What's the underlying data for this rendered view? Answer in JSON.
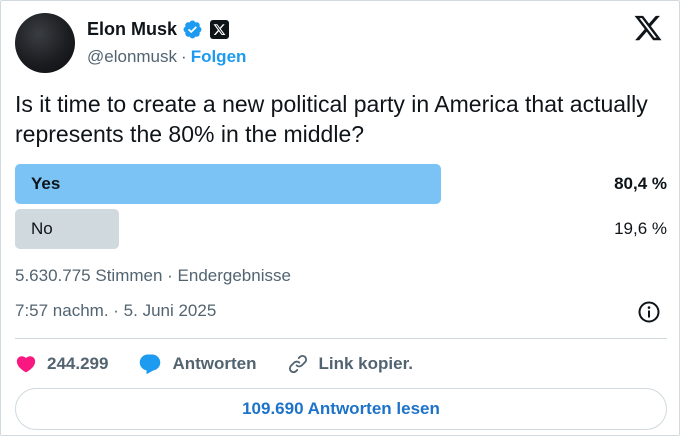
{
  "author": {
    "name": "Elon Musk",
    "handle": "@elonmusk",
    "separator": "·",
    "follow_label": "Folgen"
  },
  "tweet": {
    "text": "Is it time to create a new political party in America that actually represents the 80% in the middle?"
  },
  "poll": {
    "options": [
      {
        "label": "Yes",
        "percent_text": "80,4 %",
        "percent": 80.4,
        "winner": true
      },
      {
        "label": "No",
        "percent_text": "19,6 %",
        "percent": 19.6,
        "winner": false
      }
    ],
    "summary": "5.630.775 Stimmen · Endergebnisse"
  },
  "timestamp": "7:57 nachm. · 5. Juni 2025",
  "actions": {
    "likes_count": "244.299",
    "reply_label": "Antworten",
    "copy_link_label": "Link kopier."
  },
  "read_replies_label": "109.690 Antworten lesen",
  "colors": {
    "accent": "#1d9bf0",
    "winner_bar": "#7cc3f5",
    "loser_bar": "#cfd9de",
    "like": "#f91880"
  },
  "icons": [
    "verified-badge-icon",
    "x-badge-icon",
    "x-logo-icon",
    "info-icon",
    "heart-icon",
    "reply-bubble-icon",
    "link-icon"
  ]
}
